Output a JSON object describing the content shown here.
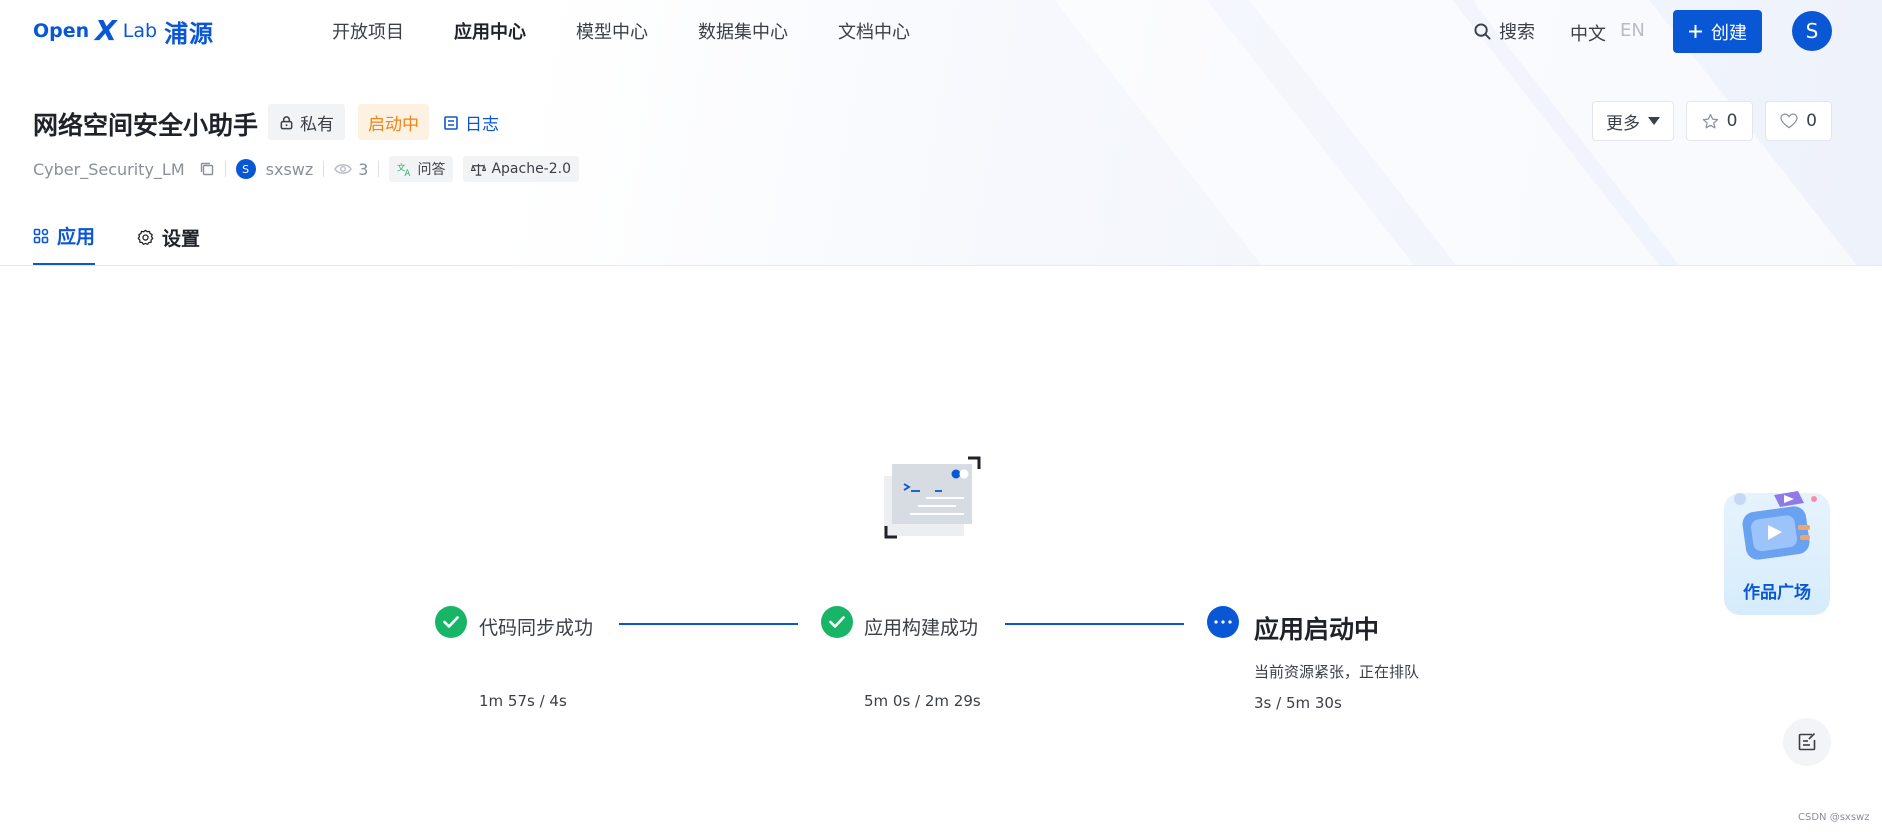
{
  "nav": {
    "logo": {
      "open": "Open",
      "x": "X",
      "lab": "Lab",
      "cn": "浦源"
    },
    "links": [
      {
        "label": "开放项目",
        "active": false
      },
      {
        "label": "应用中心",
        "active": true
      },
      {
        "label": "模型中心",
        "active": false
      },
      {
        "label": "数据集中心",
        "active": false
      },
      {
        "label": "文档中心",
        "active": false
      }
    ],
    "search_label": "搜索",
    "lang_zh": "中文",
    "lang_en": "EN",
    "create_label": "创建",
    "avatar_letter": "S"
  },
  "app": {
    "title": "网络空间安全小助手",
    "visibility": "私有",
    "status": "启动中",
    "log_label": "日志",
    "slug": "Cyber_Security_LM",
    "owner_initial": "S",
    "owner": "sxswz",
    "views": "3",
    "tags": [
      "问答",
      "Apache-2.0"
    ],
    "more_label": "更多",
    "stars": "0",
    "likes": "0"
  },
  "tabs": [
    {
      "label": "应用",
      "icon": "apps-grid-icon",
      "active": true
    },
    {
      "label": "设置",
      "icon": "gear-icon",
      "active": false
    }
  ],
  "steps": [
    {
      "label": "代码同步成功",
      "time": "1m 57s / 4s",
      "state": "done"
    },
    {
      "label": "应用构建成功",
      "time": "5m 0s / 2m 29s",
      "state": "done"
    },
    {
      "label": "应用启动中",
      "desc": "当前资源紧张，正在排队",
      "time": "3s / 5m 30s",
      "state": "running"
    }
  ],
  "gallery_label": "作品广场",
  "watermark": "CSDN @sxswz",
  "colors": {
    "primary": "#0a57d6",
    "success": "#19b567",
    "warning": "#f0851a"
  }
}
